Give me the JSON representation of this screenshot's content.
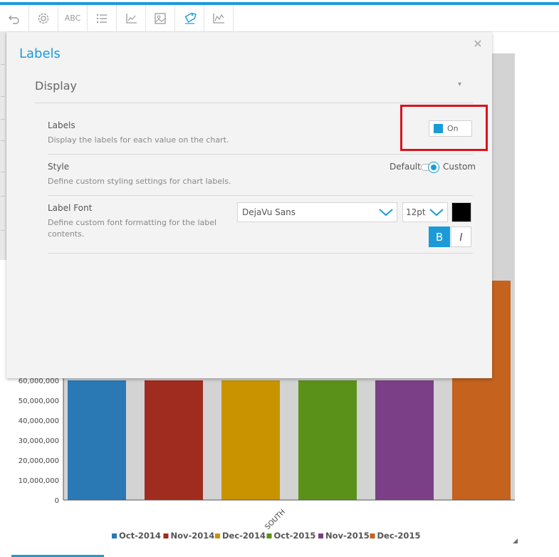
{
  "toolbar": {
    "buttons": [
      {
        "name": "undo-icon"
      },
      {
        "name": "settings-gear-icon"
      },
      {
        "name": "abc-text-icon",
        "label": "ABC"
      },
      {
        "name": "list-icon"
      },
      {
        "name": "axes-icon"
      },
      {
        "name": "image-icon"
      },
      {
        "name": "label-tag-icon",
        "active": true
      },
      {
        "name": "trend-line-icon"
      }
    ],
    "accent_color": "#1a9bd7"
  },
  "modal": {
    "title": "Labels",
    "section_title": "Display",
    "rows": {
      "labels": {
        "label": "Labels",
        "description": "Display the labels for each value on the chart.",
        "toggle_state": "On"
      },
      "style": {
        "label": "Style",
        "description": "Define custom styling settings for chart labels.",
        "option_default": "Default",
        "option_custom": "Custom",
        "selected": "Custom"
      },
      "label_font": {
        "label": "Label Font",
        "description": "Define custom font formatting for the label contents.",
        "font_value": "DejaVu Sans",
        "size_value": "12pt",
        "color": "#000000",
        "bold_label": "B",
        "italic_label": "I",
        "bold_active": true
      }
    },
    "highlight_color": "#d8141c"
  },
  "chart_data": {
    "type": "bar",
    "categories": [
      "SOUTH"
    ],
    "series": [
      {
        "name": "Oct-2014",
        "values": [
          60000000
        ],
        "color": "#2a79b4"
      },
      {
        "name": "Nov-2014",
        "values": [
          60000000
        ],
        "color": "#a02b1f"
      },
      {
        "name": "Dec-2014",
        "values": [
          60000000
        ],
        "color": "#c99300"
      },
      {
        "name": "Oct-2015",
        "values": [
          60000000
        ],
        "color": "#5a9219"
      },
      {
        "name": "Nov-2015",
        "values": [
          60000000
        ],
        "color": "#7a3f86"
      },
      {
        "name": "Dec-2015",
        "values": [
          110000000
        ],
        "color": "#c4621e"
      }
    ],
    "y_ticks": [
      "0",
      "10,000,000",
      "20,000,000",
      "30,000,000",
      "40,000,000",
      "50,000,000",
      "60,000,000"
    ],
    "ylim": [
      0,
      110000000
    ],
    "legend_position": "bottom",
    "grid": false
  }
}
